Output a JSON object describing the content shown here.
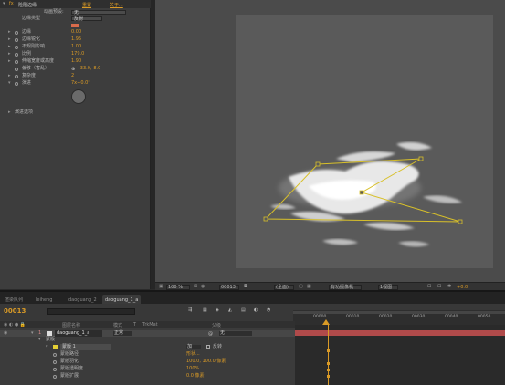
{
  "effect_panel": {
    "effect_name": "险阻边缘",
    "reset_label": "重置",
    "about_label": "关于...",
    "animation_preset_label": "动画预设:",
    "animation_preset_value": "无",
    "rows": [
      {
        "label": "边缘类型",
        "value": "反射"
      },
      {
        "label": "",
        "value": ""
      },
      {
        "label": "边缘",
        "value": "0.00"
      },
      {
        "label": "边缘锐化",
        "value": "1.95"
      },
      {
        "label": "不规则影响",
        "value": "1.00"
      },
      {
        "label": "比例",
        "value": "179.0"
      },
      {
        "label": "伸缩宽度或高度",
        "value": "1.90"
      },
      {
        "label": "偏移（害乱）",
        "value": "-33.0,-8.0"
      },
      {
        "label": "复杂度",
        "value": "2"
      },
      {
        "label": "演进",
        "value": "7x+0.0°"
      }
    ],
    "extra_label": "演进选项"
  },
  "composition": {
    "background": "#5a5a5a"
  },
  "viewer_bar": {
    "zoom": "100 %",
    "timecode": "00013",
    "resolution": "(全面)",
    "camera": "有功摄像机",
    "views": "1视图",
    "exposure": "+0.0"
  },
  "tabs": [
    {
      "label": "渲染队列",
      "active": false
    },
    {
      "label": "leiheng",
      "active": false
    },
    {
      "label": "daoguang_2",
      "active": false
    },
    {
      "label": "daoguang_1_a",
      "active": true
    }
  ],
  "timeline": {
    "current_time": "00013",
    "search_placeholder": "ρ▾",
    "col_headers": [
      "图层名称",
      "模式",
      "T",
      "TrkMat",
      "父级"
    ],
    "layers": [
      {
        "num": "1",
        "name": "daoguang_1_a",
        "mode": "正常",
        "parent": "无"
      },
      {
        "num": "",
        "name": "蒙版",
        "mode": "",
        "parent": ""
      },
      {
        "num": "",
        "name": "蒙版 1",
        "mode": "加",
        "parent": "反转"
      },
      {
        "num": "",
        "name": "蒙版路径",
        "mode": "",
        "parent": "形状..."
      },
      {
        "num": "",
        "name": "蒙版羽化",
        "mode": "",
        "parent": "100.0, 100.0 像素"
      },
      {
        "num": "",
        "name": "蒙版透明度",
        "mode": "",
        "parent": "100%"
      },
      {
        "num": "",
        "name": "蒙版扩展",
        "mode": "",
        "parent": "0.0 像素"
      }
    ],
    "ruler_ticks": [
      "00000",
      "00010",
      "00020",
      "00030",
      "00040",
      "00050",
      "00060"
    ]
  }
}
